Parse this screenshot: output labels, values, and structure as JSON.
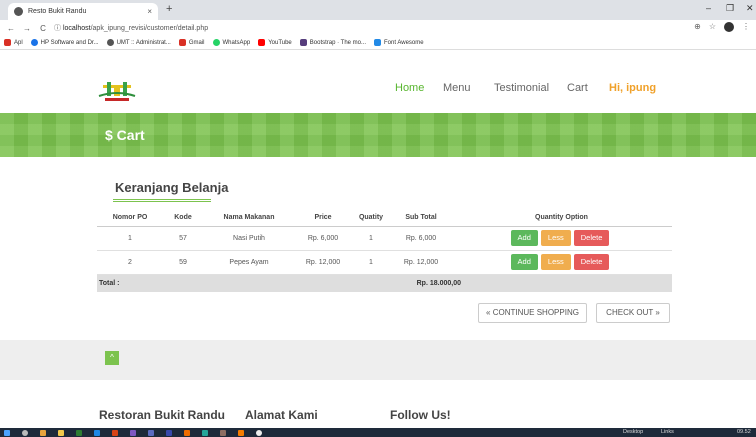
{
  "browser": {
    "tab_title": "Resto Bukit Randu",
    "tab_close": "×",
    "new_tab": "+",
    "minimize": "–",
    "restore": "❐",
    "close": "✕",
    "back": "←",
    "forward": "→",
    "reload": "C",
    "info": "ⓘ",
    "url_host": "localhost",
    "url_path": "/apk_ipung_revisi/customer/detail.php",
    "zoom": "⊕",
    "star": "☆",
    "more": "⋮",
    "bookmarks": [
      {
        "label": "Apl",
        "color": "#d93025"
      },
      {
        "label": "HP Software and Dr...",
        "color": "#1a73e8"
      },
      {
        "label": "UMT :: Administrat...",
        "color": "#555555"
      },
      {
        "label": "Gmail",
        "color": "#d93025"
      },
      {
        "label": "WhatsApp",
        "color": "#25d366"
      },
      {
        "label": "YouTube",
        "color": "#ff0000"
      },
      {
        "label": "Bootstrap · The mo...",
        "color": "#563d7c"
      },
      {
        "label": "Font Awesome",
        "color": "#228ae6"
      }
    ]
  },
  "nav": {
    "items": [
      "Home",
      "Menu",
      "Testimonial",
      "Cart"
    ],
    "active": "Home",
    "user_greeting": "Hi, ipung"
  },
  "banner": {
    "title": "$ Cart"
  },
  "cart": {
    "heading": "Keranjang Belanja",
    "columns": [
      "Nomor PO",
      "Kode",
      "Nama Makanan",
      "Price",
      "Quatity",
      "Sub Total",
      "Quantity Option"
    ],
    "rows": [
      {
        "no": "1",
        "kode": "57",
        "nama": "Nasi Putih",
        "price": "Rp. 6,000",
        "qty": "1",
        "subtotal": "Rp. 6,000"
      },
      {
        "no": "2",
        "kode": "59",
        "nama": "Pepes Ayam",
        "price": "Rp. 12,000",
        "qty": "1",
        "subtotal": "Rp. 12,000"
      }
    ],
    "option_buttons": {
      "add": "Add",
      "less": "Less",
      "delete": "Delete"
    },
    "total_label": "Total :",
    "total_value": "Rp. 18.000,00",
    "continue_label": "« CONTINUE SHOPPING",
    "checkout_label": "CHECK OUT »"
  },
  "footer": {
    "scroll_top": "^",
    "columns": [
      "Restoran Bukit Randu",
      "Alamat Kami",
      "Follow Us!"
    ]
  },
  "taskbar": {
    "desktop_label": "Desktop",
    "links_label": "Links",
    "time": "09.52"
  },
  "colors": {
    "accent_green": "#7cc34e",
    "add": "#5cb85c",
    "less": "#f0ad4e",
    "delete": "#e65a5a",
    "user": "#f0a12a"
  }
}
